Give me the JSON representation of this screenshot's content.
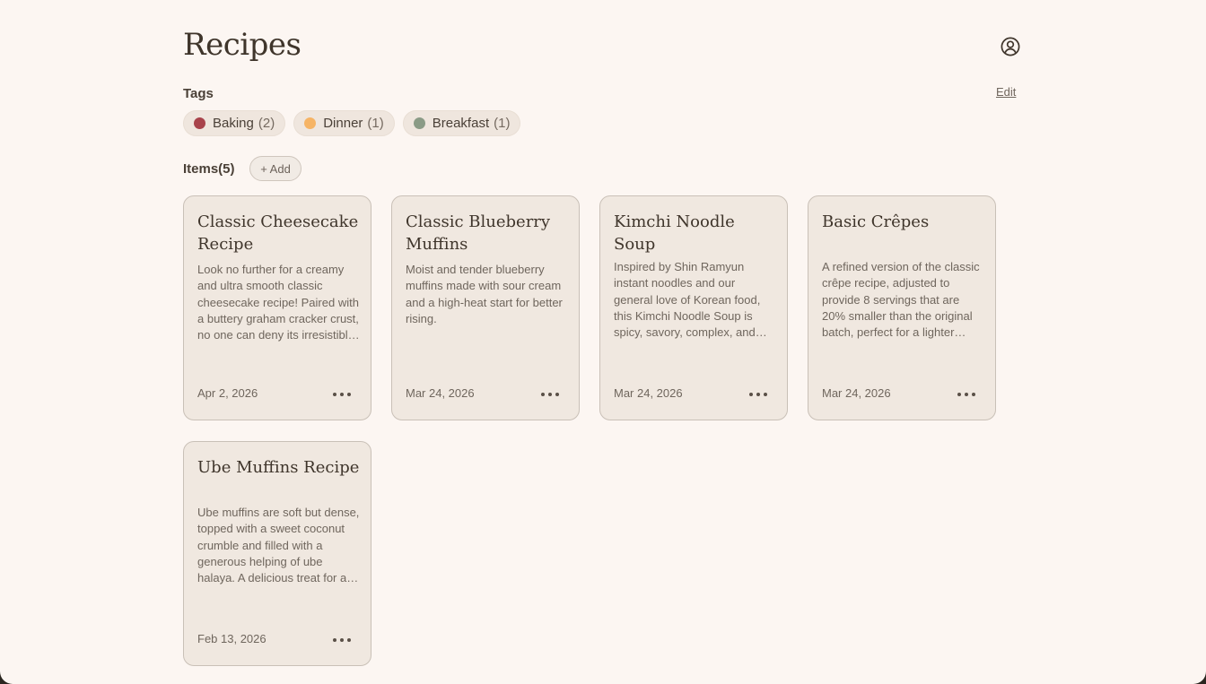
{
  "header": {
    "title": "Recipes",
    "account_icon": "user-circle-icon"
  },
  "tags": {
    "label": "Tags",
    "edit_label": "Edit",
    "items": [
      {
        "name": "Baking",
        "count": "(2)",
        "color": "#a8434b"
      },
      {
        "name": "Dinner",
        "count": "(1)",
        "color": "#f6b465"
      },
      {
        "name": "Breakfast",
        "count": "(1)",
        "color": "#8a9b86"
      }
    ]
  },
  "items": {
    "label": "Items(5)",
    "add_label": "+ Add",
    "cards": [
      {
        "title": "Classic Cheesecake Recipe",
        "description": "Look no further for a creamy and ultra smooth classic cheesecake recipe! Paired with a buttery graham cracker crust, no one can deny its irresistible appeal.",
        "date": "Apr 2, 2026"
      },
      {
        "title": "Classic Blueberry Muffins",
        "description": "Moist and tender blueberry muffins made with sour cream and a high-heat start for better rising.",
        "date": "Mar 24, 2026"
      },
      {
        "title": "Kimchi Noodle Soup",
        "description": "Inspired by Shin Ramyun instant noodles and our general love of Korean food, this Kimchi Noodle Soup is spicy, savory, complex, and comforting.",
        "date": "Mar 24, 2026"
      },
      {
        "title": "Basic Crêpes",
        "description": "A refined version of the classic crêpe recipe, adjusted to provide 8 servings that are 20% smaller than the original batch, perfect for a lighter breakfast.",
        "date": "Mar 24, 2026"
      },
      {
        "title": "Ube Muffins Recipe",
        "description": "Ube muffins are soft but dense, topped with a sweet coconut crumble and filled with a generous helping of ube halaya. A delicious treat for any time of day.",
        "date": "Feb 13, 2026"
      }
    ]
  }
}
